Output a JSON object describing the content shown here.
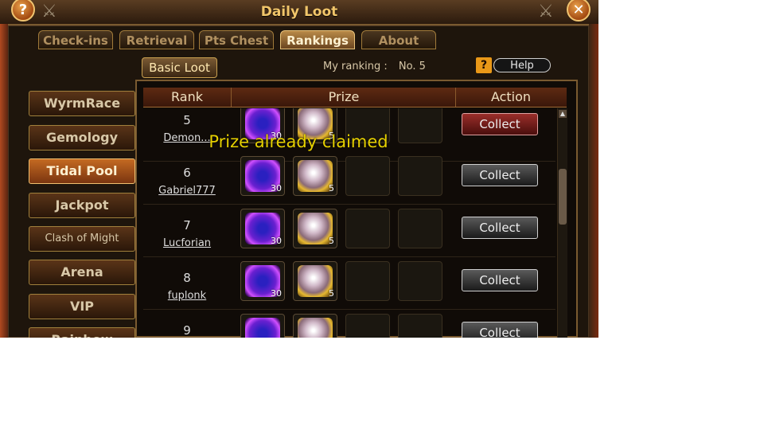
{
  "window": {
    "title": "Daily Loot"
  },
  "titlebar": {
    "help_icon": "?",
    "close_icon": "✕"
  },
  "tabs": [
    {
      "label": "Check-ins"
    },
    {
      "label": "Retrieval"
    },
    {
      "label": "Pts Chest"
    },
    {
      "label": "Rankings"
    },
    {
      "label": "About"
    }
  ],
  "subtab": {
    "label": "Basic Loot"
  },
  "my_ranking": {
    "label": "My ranking :",
    "value": "No. 5"
  },
  "help": {
    "icon": "?",
    "label": "Help"
  },
  "sidebar": {
    "items": [
      {
        "label": "WyrmRace"
      },
      {
        "label": "Gemology"
      },
      {
        "label": "Tidal Pool"
      },
      {
        "label": "Jackpot"
      },
      {
        "label": "Clash of Might"
      },
      {
        "label": "Arena"
      },
      {
        "label": "VIP"
      },
      {
        "label": "Rainbow"
      }
    ]
  },
  "table": {
    "headers": {
      "rank": "Rank",
      "prize": "Prize",
      "action": "Action"
    },
    "rows": [
      {
        "rank": "5",
        "name": "Demon...",
        "item1_qty": "30",
        "item2_qty": "5",
        "action": "Collect"
      },
      {
        "rank": "6",
        "name": "Gabriel777",
        "item1_qty": "30",
        "item2_qty": "5",
        "action": "Collect"
      },
      {
        "rank": "7",
        "name": "Lucforian",
        "item1_qty": "30",
        "item2_qty": "5",
        "action": "Collect"
      },
      {
        "rank": "8",
        "name": "fuplonk",
        "item1_qty": "30",
        "item2_qty": "5",
        "action": "Collect"
      },
      {
        "rank": "9",
        "name": "",
        "item1_qty": "",
        "item2_qty": "",
        "action": "Collect"
      }
    ]
  },
  "notice": "Prize already claimed",
  "colors": {
    "accent_gold": "#f2c66a",
    "notice_yellow": "#e6d000",
    "collect_red": "#9a2e2a"
  }
}
